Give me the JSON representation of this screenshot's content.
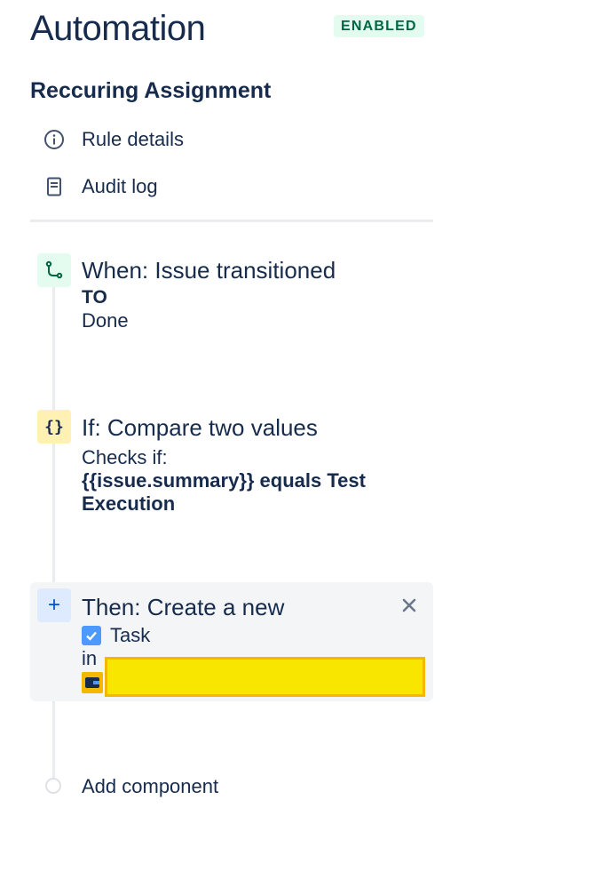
{
  "header": {
    "title": "Automation",
    "status_badge": "ENABLED"
  },
  "rule": {
    "name": "Reccuring Assignment"
  },
  "nav": [
    {
      "icon": "info-icon",
      "label": "Rule details"
    },
    {
      "icon": "document-icon",
      "label": "Audit log"
    }
  ],
  "trigger": {
    "icon": "transition-icon",
    "heading": "When: Issue transitioned",
    "to_label": "TO",
    "status": "Done"
  },
  "condition": {
    "icon": "braces-icon",
    "icon_text": "{}",
    "heading": "If: Compare two values",
    "checks_label": "Checks if:",
    "expression": "{{issue.summary}} equals Test Execution"
  },
  "action": {
    "icon": "plus-icon",
    "icon_text": "+",
    "heading": "Then: Create a new",
    "issue_type": "Task",
    "in_label": "in"
  },
  "add_component": {
    "label": "Add component"
  },
  "colors": {
    "text": "#172b4d",
    "badge_bg": "#e3fcef",
    "badge_text": "#006644",
    "trigger_icon_bg": "#e3fcef",
    "condition_icon_bg": "#fff0b3",
    "action_icon_bg": "#deebff",
    "card_bg": "#f4f5f7",
    "redaction": "#f8e500"
  }
}
